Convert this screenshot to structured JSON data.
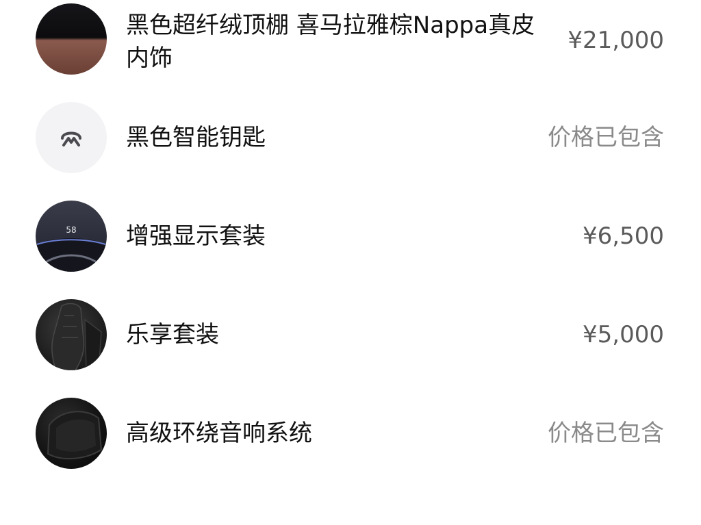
{
  "items": [
    {
      "name": "黑色超纤绒顶棚 喜马拉雅棕Nappa真皮内饰",
      "name_line1": "黑色超纤绒顶棚 喜马拉雅棕Nappa真皮",
      "name_line2": "内饰",
      "price": "¥21,000",
      "thumb_icon": "interior-trim-image"
    },
    {
      "name": "黑色智能钥匙",
      "price": "价格已包含",
      "thumb_icon": "smart-key-icon"
    },
    {
      "name": "增强显示套装",
      "price": "¥6,500",
      "thumb_icon": "display-package-image",
      "thumb_text": "58"
    },
    {
      "name": "乐享套装",
      "price": "¥5,000",
      "thumb_icon": "seat-package-image"
    },
    {
      "name": "高级环绕音响系统",
      "price": "价格已包含",
      "thumb_icon": "audio-system-image"
    }
  ],
  "colors": {
    "name_text": "#111111",
    "price_text": "#5a5a5a",
    "included_text": "#8a8a8a",
    "leather_brown": "#8a5a4e"
  }
}
